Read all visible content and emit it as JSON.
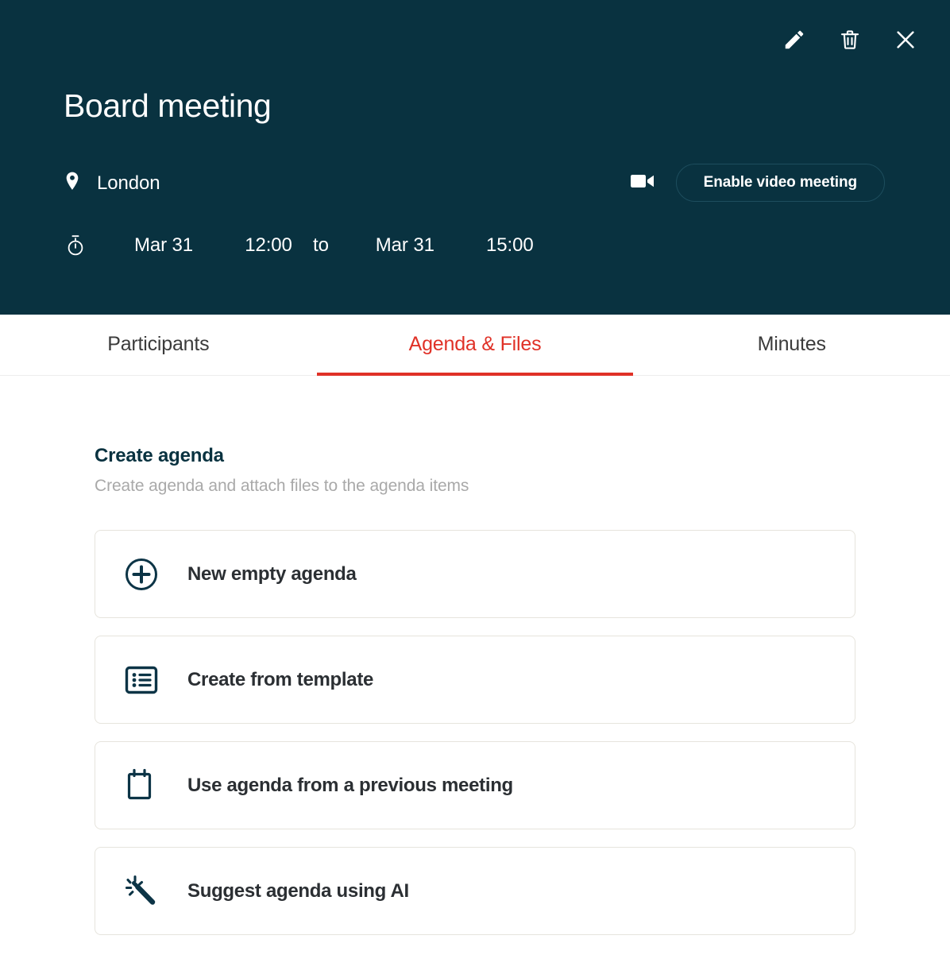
{
  "theme": {
    "header_bg": "#093240",
    "accent_red": "#e03127",
    "card_border": "#e6e4dd",
    "text_dark": "#2b2f33",
    "muted": "#a9a9a9"
  },
  "header": {
    "title": "Board meeting",
    "location": "London",
    "location_icon": "map-pin-icon",
    "time_icon": "stopwatch-icon",
    "start_date": "Mar 31",
    "start_time": "12:00",
    "separator": "to",
    "end_date": "Mar 31",
    "end_time": "15:00",
    "video_button_label": "Enable video meeting",
    "video_icon": "video-camera-icon",
    "actions": [
      {
        "name": "edit-button",
        "icon": "pencil-icon"
      },
      {
        "name": "delete-button",
        "icon": "trash-icon"
      },
      {
        "name": "close-button",
        "icon": "close-icon"
      }
    ]
  },
  "tabs": [
    {
      "label": "Participants",
      "active": false
    },
    {
      "label": "Agenda & Files",
      "active": true
    },
    {
      "label": "Minutes",
      "active": false
    }
  ],
  "main": {
    "section_title": "Create agenda",
    "section_subtitle": "Create agenda and attach files to the agenda items",
    "options": [
      {
        "label": "New empty agenda",
        "icon": "plus-circle-icon"
      },
      {
        "label": "Create from template",
        "icon": "list-icon"
      },
      {
        "label": "Use agenda from a previous meeting",
        "icon": "calendar-icon"
      },
      {
        "label": "Suggest agenda using AI",
        "icon": "magic-wand-icon"
      }
    ]
  }
}
